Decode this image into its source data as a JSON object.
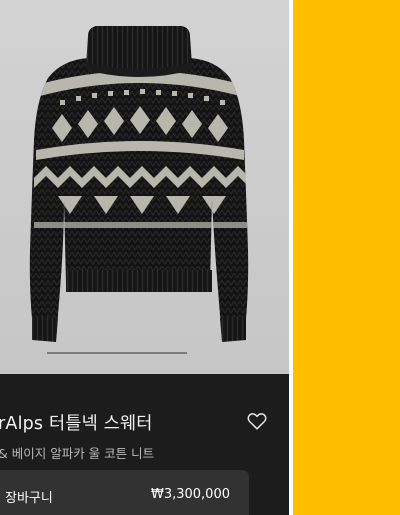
{
  "product": {
    "title": "rAlps 터틀넥 스웨터",
    "subtitle": "& 베이지 알파카 울 코튼 니트",
    "image": "black-and-beige-fair-isle-turtleneck-sweater"
  },
  "icons": {
    "wishlist": "heart-outline-icon"
  },
  "cart": {
    "label": "장바구니",
    "price": "₩3,300,000"
  },
  "carousel": {
    "current_slide": 1
  },
  "colors": {
    "panel_background": "#1c1c1c",
    "image_background": "#cfcfcf",
    "cart_button": "#323232",
    "accent_panel": "#ffbf00",
    "sweater_body": "#121212",
    "sweater_pattern": "#b7b7ae"
  }
}
